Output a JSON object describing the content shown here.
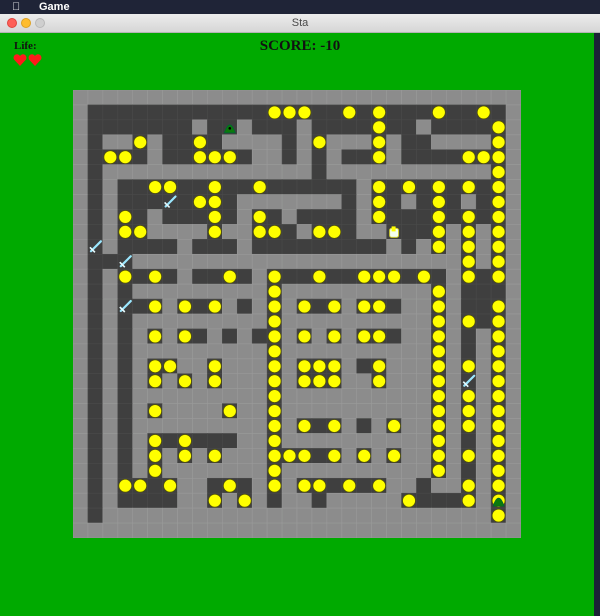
{
  "menubar": {
    "apple_icon": "apple-logo-icon",
    "app_name": "Game"
  },
  "window": {
    "title": "Sta"
  },
  "hud": {
    "life_label": "Life:",
    "lives": 2,
    "score_text": "SCORE: -10"
  },
  "colors": {
    "background": "#00aa00",
    "wall": "#8c8c8c",
    "floor": "#3f3f3f",
    "coin": "#ffff00",
    "coin_border": "#555500",
    "heart": "#ff1a1a",
    "sword": "#9be7ff",
    "enemy": "#0a7a0a"
  },
  "board": {
    "cols": 30,
    "rows": 30,
    "legend": {
      "W": "wall",
      "F": "floor",
      "o": "coin",
      "S": "sword",
      "P": "player",
      "E": "enemy"
    },
    "grid": [
      "WWWWWWWWWWWWWWWWWWWWWWWWWWWWWW",
      "WFFFFFFFFFFFFoooFFoFoFFFoFFoFW",
      "WFFFFFFFWFEWFFFWFFFFoFFWFFFFoW",
      "WFWWoWFFoFWWWWFWoWWWoWFFWWWWoW",
      "WFooFWFFoooFWWFWFWFFoWFFFFoooW",
      "WFWWWWWWWWWWWWWWFWWWWWWWWWWWoW",
      "WFWFFooFFoFFoFFFFFFWoFoFoFoFoW",
      "WFWFFFSFooFWWWWWWWFWoFWFoFWFoW",
      "WFWoFWFFFoFWoFWFFFFWoFFFoFoFoW",
      "WFWooWWWWoWWooFWoowWWPFFoWoWoW",
      "WSWFFFFWFFFWFFFFFFFFFWFWoWoWoW",
      "WFFSWWWWWWWWWWWWWWWWWWWWWWoWoW",
      "WFWoFoFWFFoFWoFFoFFoooFoFWoFoW",
      "WFWFWWWWWWWWWoWWWWWWWWWWoWFFFW",
      "WFWSFoWoFoWFWoWoFoWooFWWoWFFoW",
      "WFWFWWWWWWWWWoWWWWWWWWWWoWoFoW",
      "WFWFWoWoFWFWFoWoWoWooFWWoWFWoW",
      "WFWFWWWWWWWWWoWWWWWWWWWWoWFWoW",
      "WFWFWooWWoWWWoWoooWFoWWWoWoWoW",
      "WFWFWoWoWoWWWoWoooWWoWWWoWSWoW",
      "WFWFWWWWWWWWWoWWWWWWWWWWoWoWoW",
      "WFWFWoWWWWoWWoWWWWWWWWWWoWoWoW",
      "WFWFWWWWWWWWWoWoFoWFWoWWoWoWoW",
      "WFWFWoFoFFFWWoWWWWWWWWWWoWFWoW",
      "WFWFWoWoWoWWWoooFoWoWoWWoWoWoW",
      "WFWFWoWWWWWWWoWWWWWWWWWWoWFWoW",
      "WFWooFoWWFoFWoWooFoFoWWFWWoWoW",
      "WFWFFFFWWoWoWFWWFWWWWWoFFFoWoW",
      "WFWWWWWWWWWWWWWWWWWWWWWWWWWWoW",
      "WWWWWWWWWWWWWWWWWWWWWWWWWWWWWW"
    ]
  }
}
